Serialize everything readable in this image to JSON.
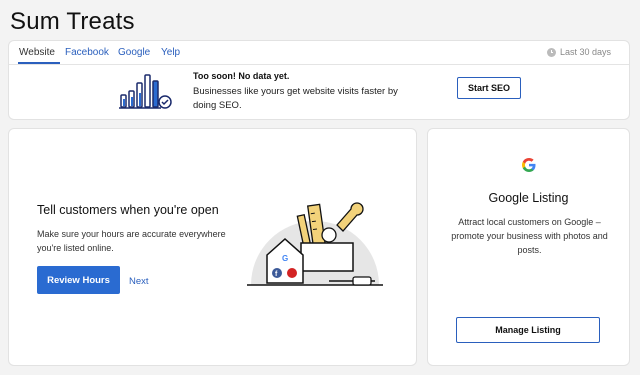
{
  "page": {
    "title": "Sum Treats"
  },
  "tabs": [
    {
      "label": "Website",
      "active": true
    },
    {
      "label": "Facebook",
      "active": false
    },
    {
      "label": "Google",
      "active": false
    },
    {
      "label": "Yelp",
      "active": false
    }
  ],
  "date_range": {
    "label": "Last 30 days",
    "icon": "clock-icon"
  },
  "seo": {
    "title": "Too soon! No data yet.",
    "description": "Businesses like yours get website visits faster by doing SEO.",
    "button": "Start SEO"
  },
  "hours": {
    "title": "Tell customers when you're open",
    "description": "Make sure your hours are accurate everywhere you're listed online.",
    "primary_button": "Review Hours",
    "next_link": "Next"
  },
  "google_listing": {
    "title": "Google Listing",
    "description": "Attract local customers on Google – promote your business with photos and posts.",
    "button": "Manage Listing"
  },
  "colors": {
    "accent": "#2a5fbd",
    "primary_button": "#2a6bd1",
    "background": "#f3f3f3"
  }
}
